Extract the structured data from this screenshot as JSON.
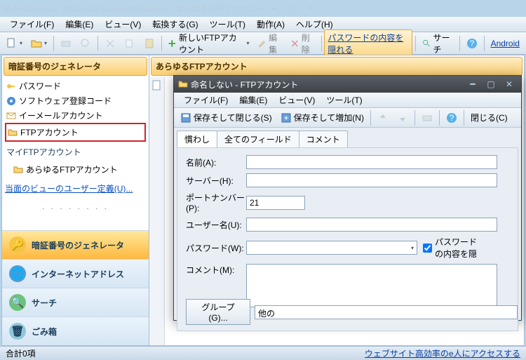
{
  "title": "MyPwd.epmw - Efficient Password Manager - あらゆるFTPアカウント",
  "menus": {
    "file": "ファイル(F)",
    "edit": "編集(E)",
    "view": "ビュー(V)",
    "convert": "転換する(G)",
    "tools": "ツール(T)",
    "action": "動作(A)",
    "help": "ヘルプ(H)"
  },
  "toolbar": {
    "new_ftp": "新しいFTPアカウント",
    "edit": "編集",
    "delete": "削除",
    "hide_pw": "パスワードの内容を隠れる",
    "search": "サーチ",
    "android": "Android"
  },
  "sidebar": {
    "header": "暗証番号のジェネレータ",
    "items": [
      {
        "label": "パスワード"
      },
      {
        "label": "ソフトウェア登録コード"
      },
      {
        "label": "イーメールアカウント"
      },
      {
        "label": "FTPアカウント"
      }
    ],
    "my_header": "マイFTPアカウント",
    "sub": {
      "label": "あらゆるFTPアカウント"
    },
    "define": "当面のビューのユーザー定義(U)...",
    "nav": [
      {
        "label": "暗証番号のジェネレータ"
      },
      {
        "label": "インターネットアドレス"
      },
      {
        "label": "サーチ"
      },
      {
        "label": "ごみ箱"
      }
    ]
  },
  "main": {
    "header": "あらゆるFTPアカウント"
  },
  "dialog": {
    "title": "命名しない - FTPアカウント",
    "menus": {
      "file": "ファイル(F)",
      "edit": "編集(E)",
      "view": "ビュー(V)",
      "tools": "ツール(T)"
    },
    "toolbar": {
      "save_close": "保存そして閉じる(S)",
      "save_add": "保存そして増加(N)",
      "close": "閉じる(C)"
    },
    "tabs": {
      "t1": "慣わし",
      "t2": "全てのフィールド",
      "t3": "コメント"
    },
    "form": {
      "name_label": "名前(A):",
      "server_label": "サーバー(H):",
      "port_label": "ポートナンバー(P):",
      "port_value": "21",
      "user_label": "ユーザー名(U):",
      "pw_label": "パスワード(W):",
      "hide_pw_chk": "パスワードの内容を隠",
      "comment_label": "コメント(M):",
      "group_btn": "グループ(G)...",
      "group_value": "他の"
    }
  },
  "status": {
    "left": "合計0項",
    "right": "ウェブサイト高効率のe人にアクセスする"
  }
}
